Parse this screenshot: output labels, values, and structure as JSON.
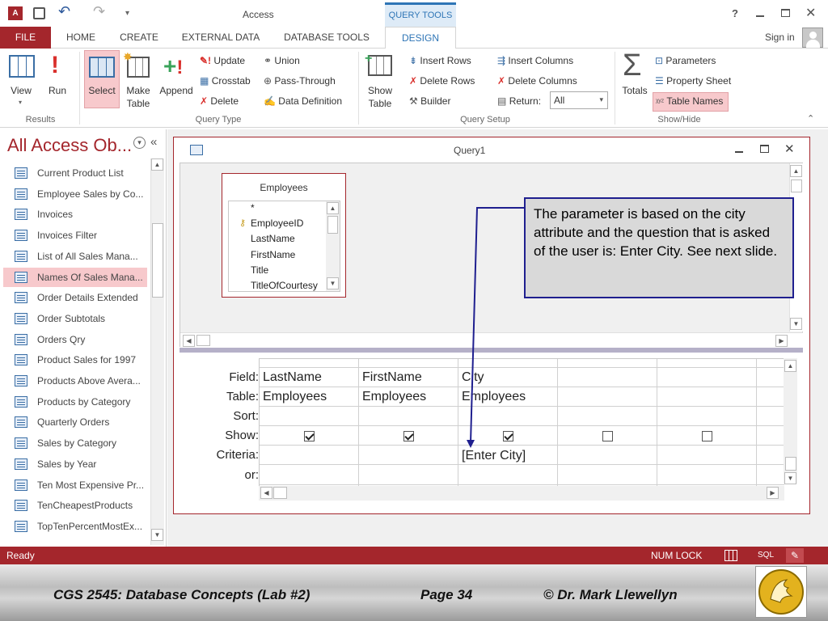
{
  "app": {
    "title": "Access",
    "context_tab_group": "QUERY TOOLS",
    "help": "?",
    "sign_in": "Sign in",
    "qat_undo": "↶",
    "qat_redo": "↷"
  },
  "ribbon_tabs": [
    "FILE",
    "HOME",
    "CREATE",
    "EXTERNAL DATA",
    "DATABASE TOOLS",
    "DESIGN"
  ],
  "ribbon": {
    "results": {
      "label": "Results",
      "view": "View",
      "run": "Run"
    },
    "query_type": {
      "label": "Query Type",
      "select": "Select",
      "make_table": [
        "Make",
        "Table"
      ],
      "append": "Append",
      "update": "Update",
      "crosstab": "Crosstab",
      "delete": "Delete",
      "union": "Union",
      "pass_through": "Pass-Through",
      "data_definition": "Data Definition"
    },
    "query_setup": {
      "label": "Query Setup",
      "show_table": [
        "Show",
        "Table"
      ],
      "insert_rows": "Insert Rows",
      "delete_rows": "Delete Rows",
      "builder": "Builder",
      "insert_columns": "Insert Columns",
      "delete_columns": "Delete Columns",
      "return_label": "Return:",
      "return_value": "All"
    },
    "show_hide": {
      "label": "Show/Hide",
      "totals": "Totals",
      "parameters": "Parameters",
      "property_sheet": "Property Sheet",
      "table_names": "Table Names"
    }
  },
  "nav": {
    "title": "All Access Ob...",
    "items": [
      "Current Product List",
      "Employee Sales by Co...",
      "Invoices",
      "Invoices Filter",
      "List of All Sales Mana...",
      "Names Of Sales Mana...",
      "Order Details Extended",
      "Order Subtotals",
      "Orders Qry",
      "Product Sales for 1997",
      "Products Above Avera...",
      "Products by Category",
      "Quarterly Orders",
      "Sales by Category",
      "Sales by Year",
      "Ten Most Expensive Pr...",
      "TenCheapestProducts",
      "TopTenPercentMostEx..."
    ],
    "selected_index": 5
  },
  "query": {
    "window_title": "Query1",
    "table": {
      "name": "Employees",
      "fields": [
        "*",
        "EmployeeID",
        "LastName",
        "FirstName",
        "Title",
        "TitleOfCourtesy"
      ]
    },
    "row_labels": [
      "Field:",
      "Table:",
      "Sort:",
      "Show:",
      "Criteria:",
      "or:"
    ],
    "columns": [
      {
        "field": "LastName",
        "table": "Employees",
        "show": true,
        "criteria": ""
      },
      {
        "field": "FirstName",
        "table": "Employees",
        "show": true,
        "criteria": ""
      },
      {
        "field": "City",
        "table": "Employees",
        "show": true,
        "criteria": "[Enter City]"
      },
      {
        "field": "",
        "table": "",
        "show": false,
        "criteria": ""
      },
      {
        "field": "",
        "table": "",
        "show": false,
        "criteria": ""
      }
    ]
  },
  "callout": {
    "text": "The parameter is based on the city attribute and the question that is asked of the user is: Enter City.  See next slide."
  },
  "status": {
    "left": "Ready",
    "num_lock": "NUM LOCK",
    "sql": "SQL"
  },
  "footer": {
    "course": "CGS 2545: Database Concepts  (Lab #2)",
    "page": "Page 34",
    "author": "© Dr. Mark Llewellyn"
  },
  "colors": {
    "accent": "#a4262c",
    "context_tab": "#2e75b6",
    "callout_border": "#1f1f8f"
  }
}
